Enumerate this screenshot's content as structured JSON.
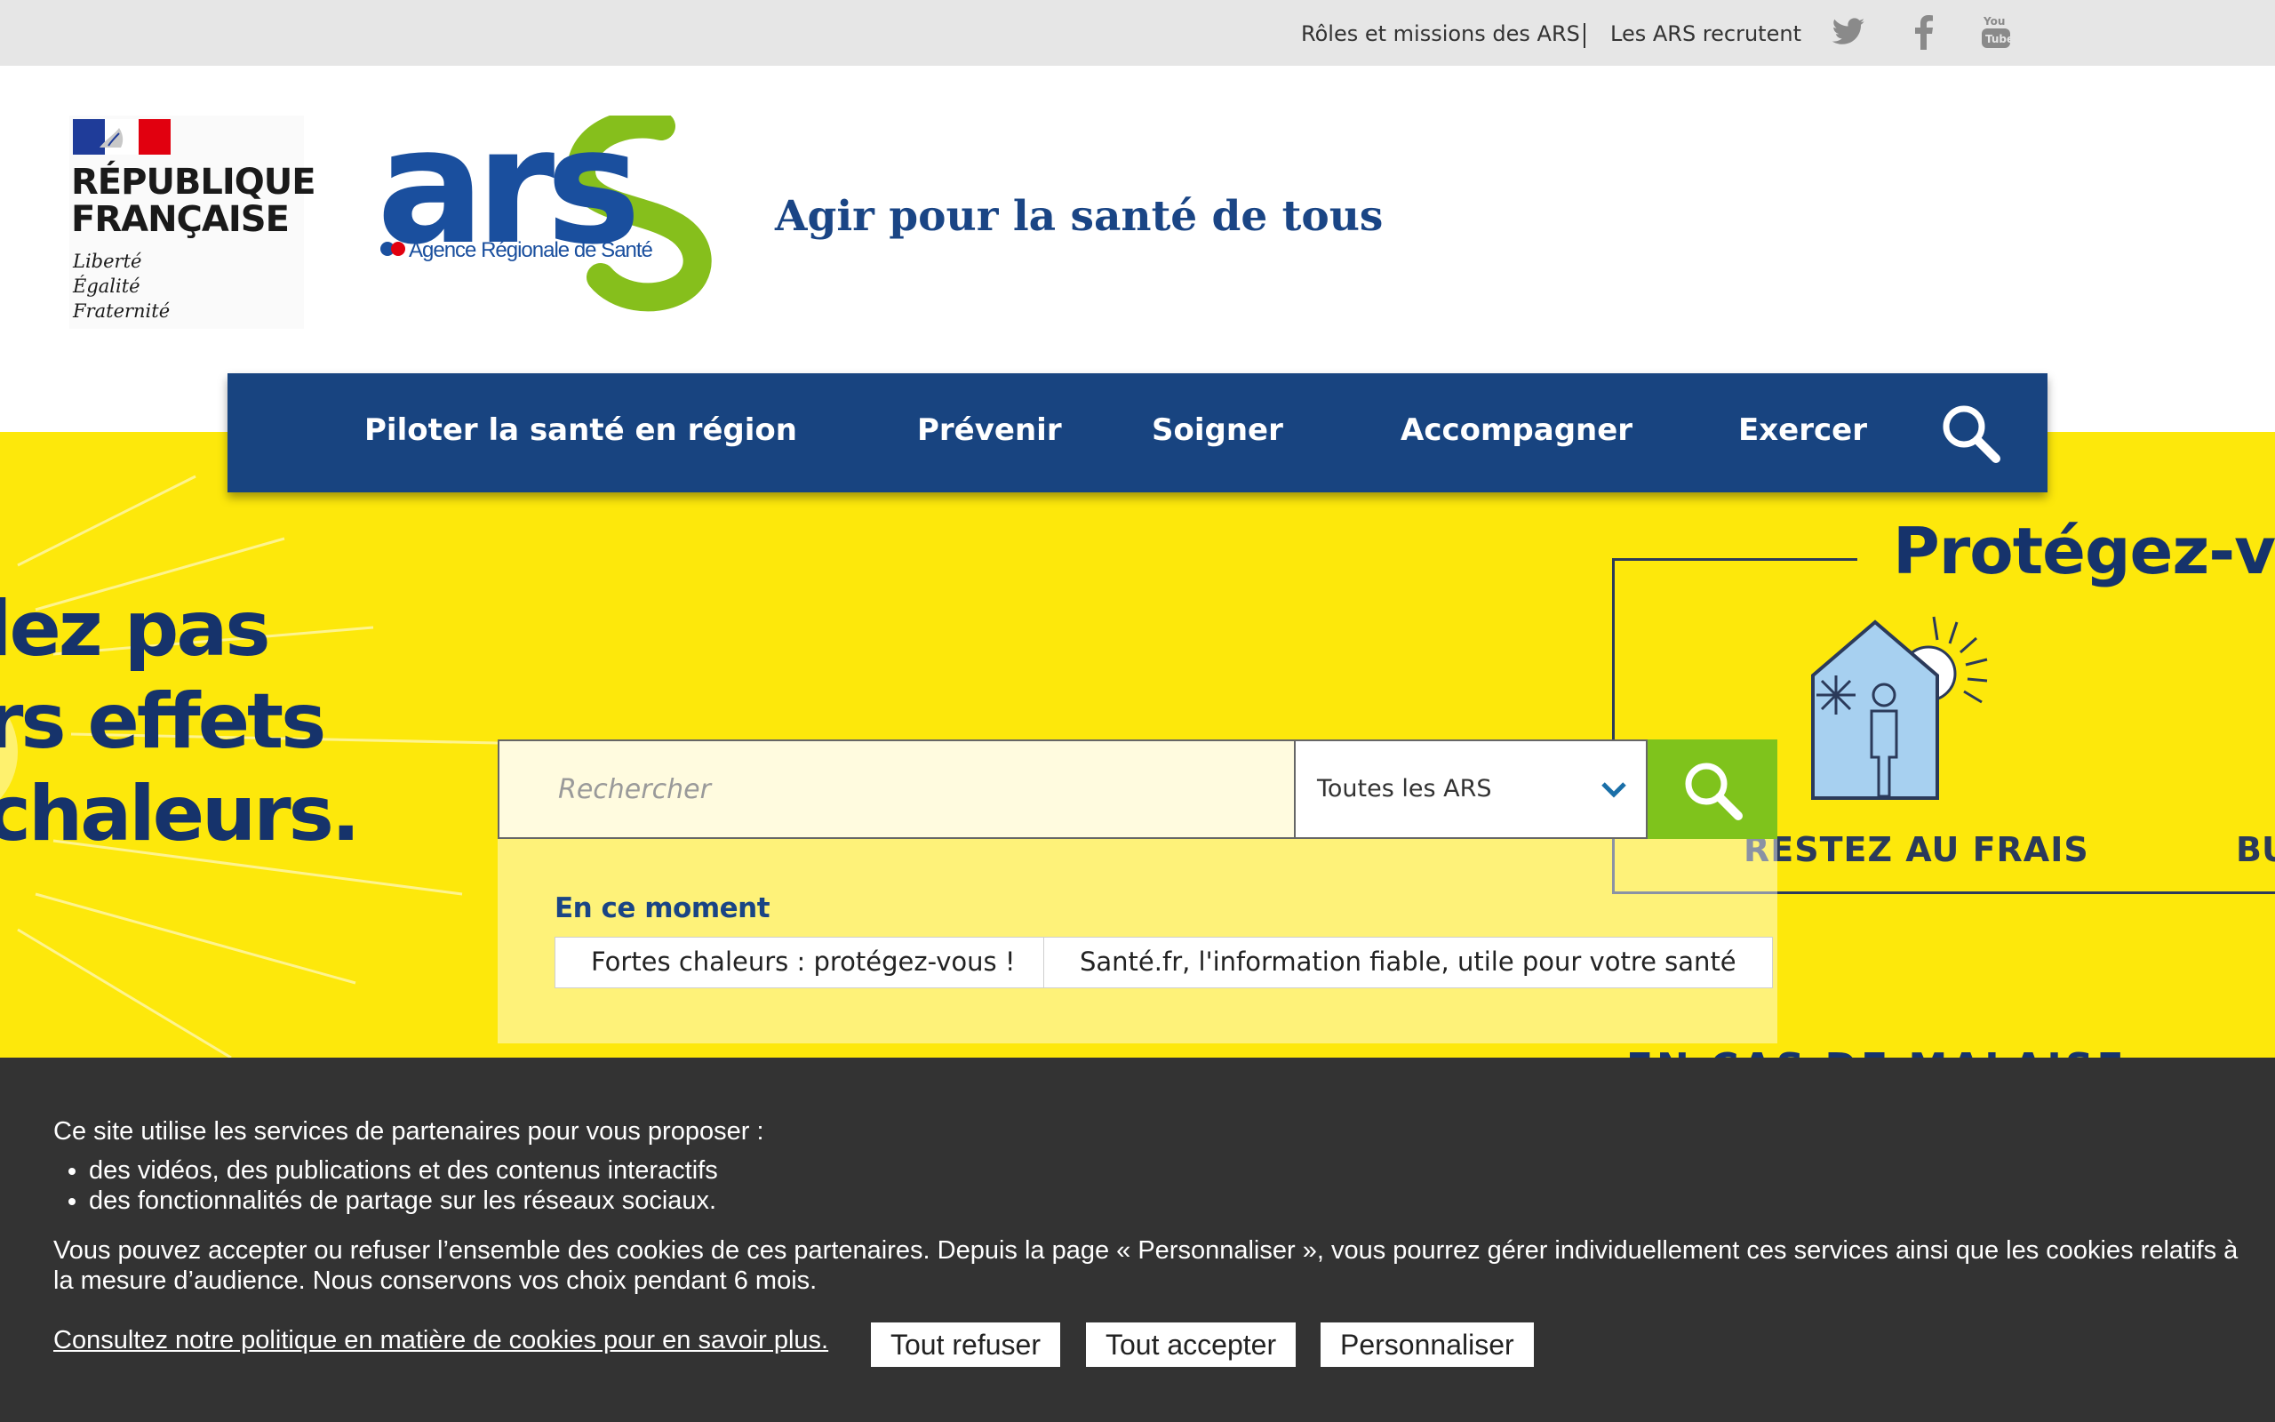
{
  "topbar": {
    "links": [
      "Rôles et missions des ARS",
      "Les ARS recrutent"
    ],
    "social_icons": [
      "twitter-icon",
      "facebook-icon",
      "youtube-icon"
    ]
  },
  "header": {
    "rf_title_line1": "RÉPUBLIQUE",
    "rf_title_line2": "FRANÇAISE",
    "rf_motto_line1": "Liberté",
    "rf_motto_line2": "Égalité",
    "rf_motto_line3": "Fraternité",
    "ars_logo_text": "ars",
    "ars_logo_subtitle": "Agence Régionale de Santé",
    "tagline": "Agir pour la santé de tous"
  },
  "nav": {
    "items": [
      "Piloter la santé en région",
      "Prévenir",
      "Soigner",
      "Accompagner",
      "Exercer"
    ],
    "search_icon": "search-icon"
  },
  "hero": {
    "text_line1": "lez pas",
    "text_line2": "rs effets",
    "text_line3": "chaleurs.",
    "protect_title": "Protégez-vo",
    "restez": "RESTEZ AU FRAIS",
    "bu": "BU",
    "bottom_text": "EN CAS DE MALAISE"
  },
  "search": {
    "placeholder": "Rechercher",
    "select_value": "Toutes les ARS",
    "moment_label": "En ce moment",
    "chips": [
      "Fortes chaleurs : protégez-vous !",
      "Santé.fr, l'information fiable, utile pour votre santé"
    ]
  },
  "cookie": {
    "intro": "Ce site utilise les services de partenaires pour vous proposer :",
    "bullets": [
      "des vidéos, des publications et des contenus interactifs",
      "des fonctionnalités de partage sur les réseaux sociaux."
    ],
    "para": "Vous pouvez accepter ou refuser l’ensemble des cookies de ces partenaires. Depuis la page « Personnaliser », vous pourrez gérer individuellement ces services ainsi que les cookies relatifs à la mesure d’audience. Nous conservons vos choix pendant 6 mois.",
    "policy_link": "Consultez notre politique en matière de cookies pour en savoir plus.",
    "refuse": "Tout refuser",
    "accept": "Tout accepter",
    "customize": "Personnaliser"
  },
  "colors": {
    "brand_blue": "#184480",
    "accent_green": "#7fc31c",
    "hero_yellow": "#fde80b"
  }
}
